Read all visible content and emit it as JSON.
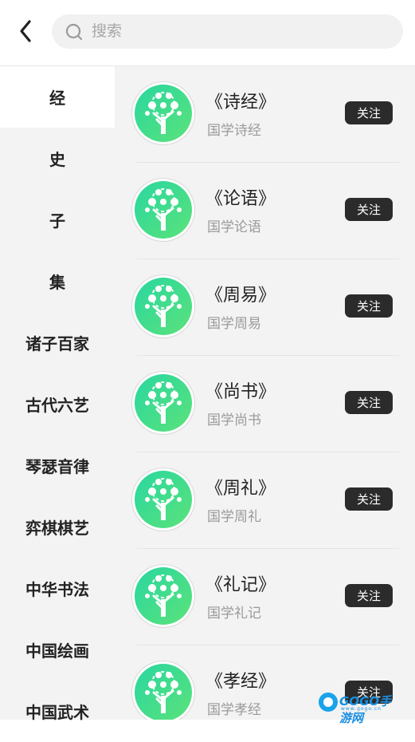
{
  "search": {
    "placeholder": "搜索"
  },
  "sidebar": {
    "items": [
      {
        "label": "经",
        "active": true
      },
      {
        "label": "史",
        "active": false
      },
      {
        "label": "子",
        "active": false
      },
      {
        "label": "集",
        "active": false
      },
      {
        "label": "诸子百家",
        "active": false
      },
      {
        "label": "古代六艺",
        "active": false
      },
      {
        "label": "琴瑟音律",
        "active": false
      },
      {
        "label": "弈棋棋艺",
        "active": false
      },
      {
        "label": "中华书法",
        "active": false
      },
      {
        "label": "中国绘画",
        "active": false
      },
      {
        "label": "中国武术",
        "active": false
      }
    ]
  },
  "content": {
    "items": [
      {
        "title": "《诗经》",
        "subtitle": "国学诗经",
        "follow_label": "关注"
      },
      {
        "title": "《论语》",
        "subtitle": "国学论语",
        "follow_label": "关注"
      },
      {
        "title": "《周易》",
        "subtitle": "国学周易",
        "follow_label": "关注"
      },
      {
        "title": "《尚书》",
        "subtitle": "国学尚书",
        "follow_label": "关注"
      },
      {
        "title": "《周礼》",
        "subtitle": "国学周礼",
        "follow_label": "关注"
      },
      {
        "title": "《礼记》",
        "subtitle": "国学礼记",
        "follow_label": "关注"
      },
      {
        "title": "《孝经》",
        "subtitle": "国学孝经",
        "follow_label": "关注"
      }
    ]
  },
  "watermark": {
    "main": "GOGO手游网",
    "sub": "www.gogo.cn"
  },
  "colors": {
    "accent_green": "#3ddc8f",
    "follow_button": "#2b2b2b",
    "sidebar_bg": "#f3f3f3"
  }
}
